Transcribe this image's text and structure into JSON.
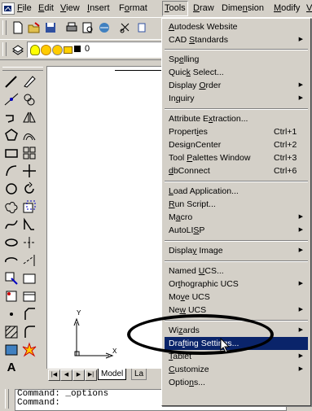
{
  "menubar": {
    "items": [
      "File",
      "Edit",
      "View",
      "Insert",
      "Format",
      "Tools",
      "Draw",
      "Dimension",
      "Modify",
      "V"
    ]
  },
  "layer_toolbar": {
    "layer_name": "0"
  },
  "tools_menu": {
    "items": [
      {
        "label": "Autodesk Website",
        "shortcut": "",
        "submenu": false
      },
      {
        "label": "CAD Standards",
        "shortcut": "",
        "submenu": true
      },
      {
        "label": "Spelling",
        "shortcut": "",
        "submenu": false
      },
      {
        "label": "Quick Select...",
        "shortcut": "",
        "submenu": false
      },
      {
        "label": "Display Order",
        "shortcut": "",
        "submenu": true
      },
      {
        "label": "Inquiry",
        "shortcut": "",
        "submenu": true
      },
      {
        "label": "Attribute Extraction...",
        "shortcut": "",
        "submenu": false
      },
      {
        "label": "Properties",
        "shortcut": "Ctrl+1",
        "submenu": false
      },
      {
        "label": "DesignCenter",
        "shortcut": "Ctrl+2",
        "submenu": false
      },
      {
        "label": "Tool Palettes Window",
        "shortcut": "Ctrl+3",
        "submenu": false
      },
      {
        "label": "dbConnect",
        "shortcut": "Ctrl+6",
        "submenu": false
      },
      {
        "label": "Load Application...",
        "shortcut": "",
        "submenu": false
      },
      {
        "label": "Run Script...",
        "shortcut": "",
        "submenu": false
      },
      {
        "label": "Macro",
        "shortcut": "",
        "submenu": true
      },
      {
        "label": "AutoLISP",
        "shortcut": "",
        "submenu": true
      },
      {
        "label": "Display Image",
        "shortcut": "",
        "submenu": true
      },
      {
        "label": "Named UCS...",
        "shortcut": "",
        "submenu": false
      },
      {
        "label": "Orthographic UCS",
        "shortcut": "",
        "submenu": true
      },
      {
        "label": "Move UCS",
        "shortcut": "",
        "submenu": false
      },
      {
        "label": "New UCS",
        "shortcut": "",
        "submenu": true
      },
      {
        "label": "Wizards",
        "shortcut": "",
        "submenu": true
      },
      {
        "label": "Drafting Settings...",
        "shortcut": "",
        "submenu": false
      },
      {
        "label": "Tablet",
        "shortcut": "",
        "submenu": true
      },
      {
        "label": "Customize",
        "shortcut": "",
        "submenu": true
      },
      {
        "label": "Options...",
        "shortcut": "",
        "submenu": false
      }
    ],
    "highlighted": "Drafting Settings..."
  },
  "ucs_icon": {
    "x_label": "X",
    "y_label": "Y"
  },
  "tabs": {
    "model": "Model",
    "layout": "La"
  },
  "command_line": {
    "line1": "Command: _options",
    "line2": "Command:"
  },
  "colors": {
    "menu_highlight": "#0a246a",
    "face": "#d4d0c8"
  }
}
